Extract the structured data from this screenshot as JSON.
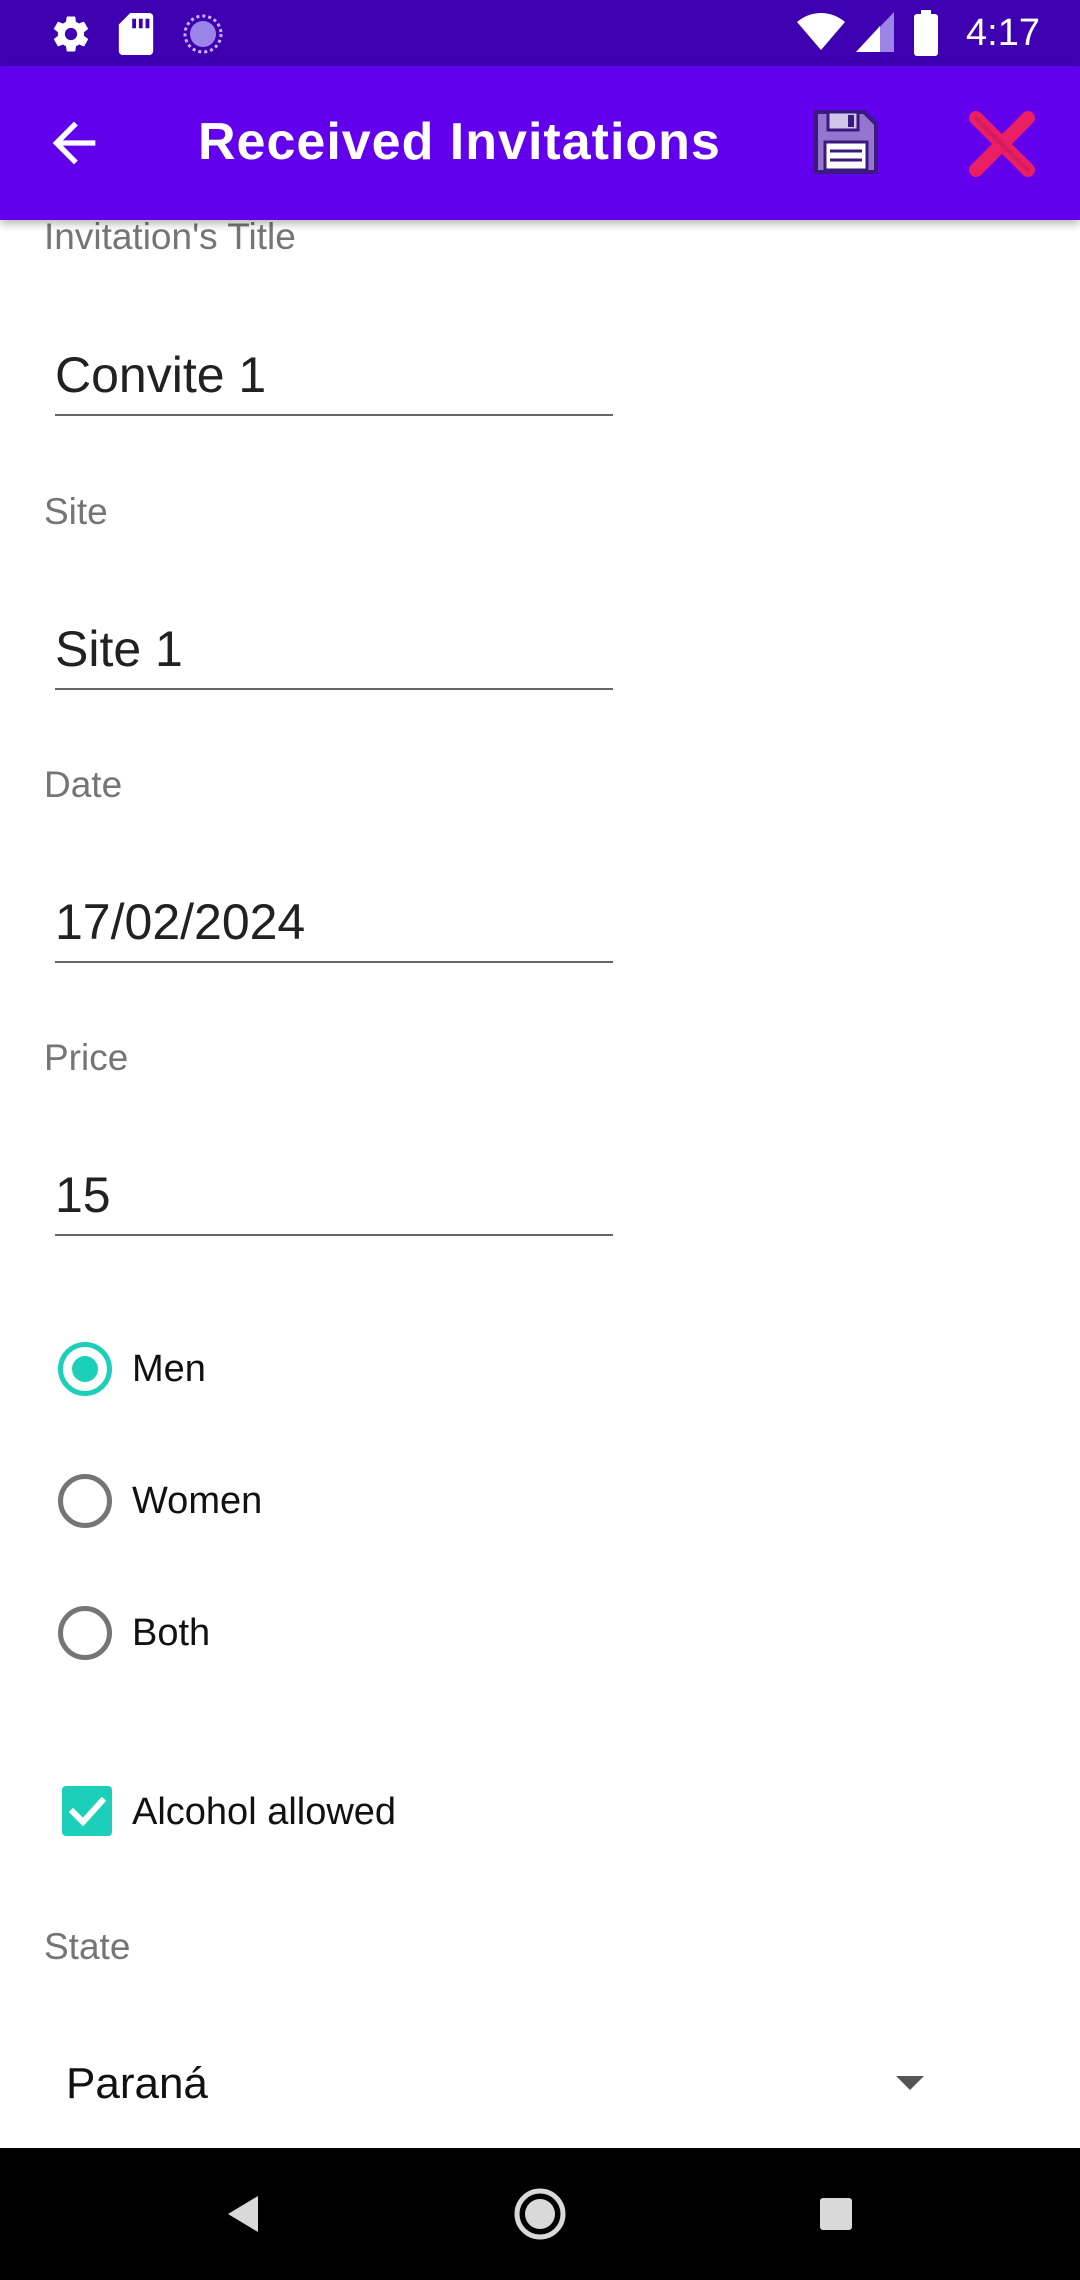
{
  "status_bar": {
    "time": "4:17",
    "icons": [
      "settings-icon",
      "sd-card-icon",
      "loading-circle-icon",
      "wifi-icon",
      "signal-icon",
      "battery-icon"
    ]
  },
  "app_bar": {
    "title": "Received Invitations",
    "back_icon": "arrow-left-icon",
    "save_icon": "floppy-disk-icon",
    "close_icon": "close-x-icon",
    "colors": {
      "status_bar": "#3e00b0",
      "app_bar": "#6200ee",
      "save_icon": "#9575cd",
      "close_icon": "#e91e63"
    }
  },
  "form": {
    "title": {
      "label": "Invitation's Title",
      "value": "Convite 1"
    },
    "site": {
      "label": "Site",
      "value": "Site 1"
    },
    "date": {
      "label": "Date",
      "value": "17/02/2024"
    },
    "price": {
      "label": "Price",
      "value": "15"
    },
    "audience": {
      "options": [
        {
          "label": "Men",
          "checked": true
        },
        {
          "label": "Women",
          "checked": false
        },
        {
          "label": "Both",
          "checked": false
        }
      ]
    },
    "alcohol": {
      "label": "Alcohol allowed",
      "checked": true
    },
    "state": {
      "label": "State",
      "value": "Paraná"
    },
    "accent_color": "#1ccfb9"
  },
  "nav_bar": {
    "buttons": [
      "back-triangle-icon",
      "home-circle-icon",
      "recents-square-icon"
    ]
  }
}
